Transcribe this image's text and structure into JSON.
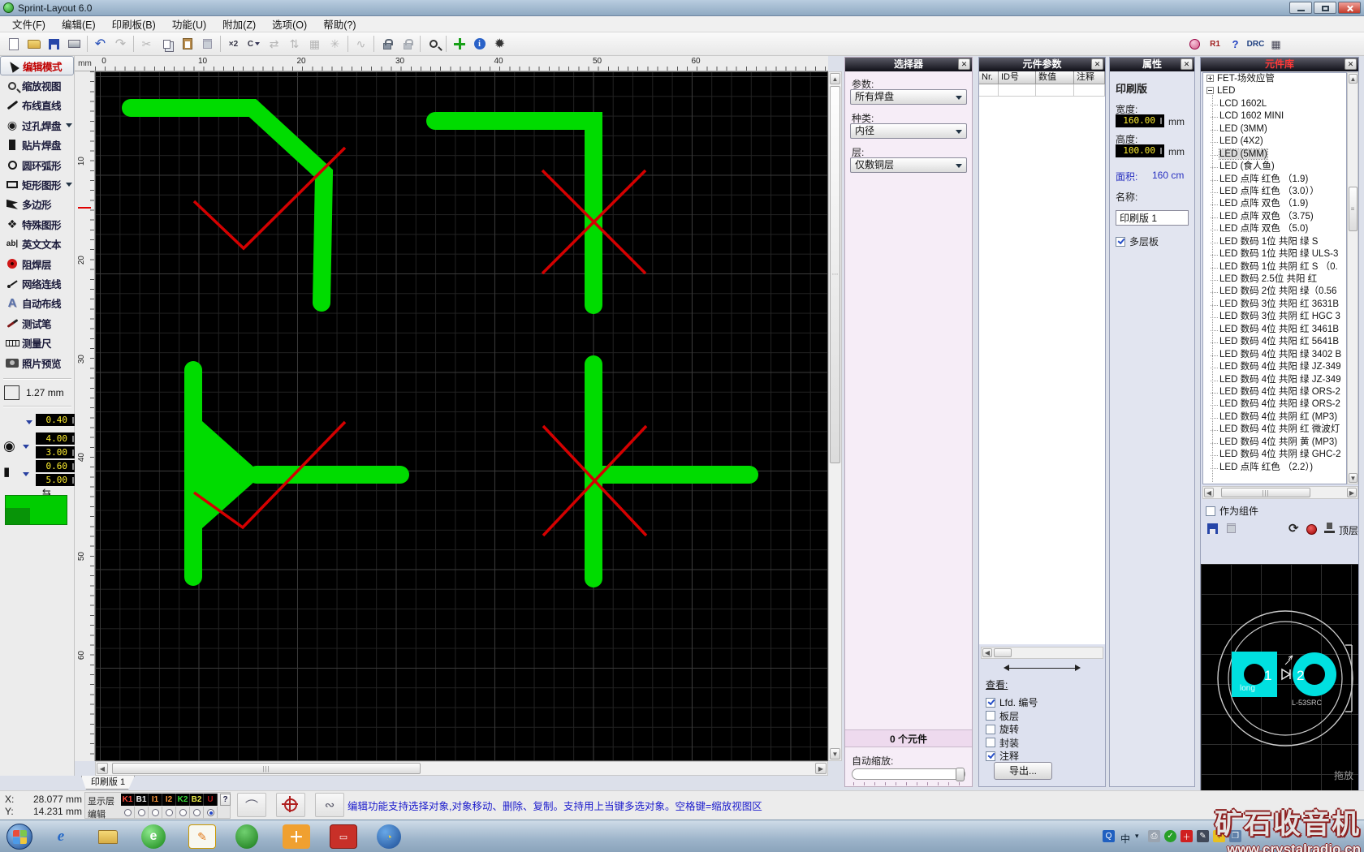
{
  "window": {
    "title": "Sprint-Layout 6.0"
  },
  "menu": {
    "items": [
      "文件(F)",
      "编辑(E)",
      "印刷板(B)",
      "功能(U)",
      "附加(Z)",
      "选项(O)",
      "帮助(?)"
    ]
  },
  "toolbar": {
    "x2": "×2",
    "rotate": "C",
    "r1": "R1",
    "help": "?",
    "drc": "DRC"
  },
  "tools": {
    "items": [
      {
        "label": "编辑模式",
        "icon": "cursor-icon",
        "active": true
      },
      {
        "label": "缩放视图",
        "icon": "magnifier-icon"
      },
      {
        "label": "布线直线",
        "icon": "line-icon"
      },
      {
        "label": "过孔焊盘",
        "icon": "pad-icon",
        "dropdown": true
      },
      {
        "label": "贴片焊盘",
        "icon": "smd-pad-icon"
      },
      {
        "label": "圆环弧形",
        "icon": "ring-icon"
      },
      {
        "label": "矩形图形",
        "icon": "rect-icon",
        "dropdown": true
      },
      {
        "label": "多边形",
        "icon": "polygon-icon"
      },
      {
        "label": "特殊图形",
        "icon": "special-shape-icon"
      },
      {
        "label": "英文文本",
        "icon": "text-icon"
      },
      {
        "label": "阻焊层",
        "icon": "solder-mask-icon"
      },
      {
        "label": "网络连线",
        "icon": "net-icon"
      },
      {
        "label": "自动布线",
        "icon": "autoroute-icon"
      },
      {
        "label": "测试笔",
        "icon": "probe-icon"
      },
      {
        "label": "测量尺",
        "icon": "ruler-icon"
      },
      {
        "label": "照片预览",
        "icon": "camera-icon"
      }
    ]
  },
  "grid": {
    "value": "1.27 mm"
  },
  "params": {
    "track": "0.40",
    "pad_outer": "4.00",
    "pad_inner": "3.00",
    "smd_w": "0.60",
    "smd_h": "5.00"
  },
  "rulers": {
    "unit": "mm",
    "top": [
      "0",
      "10",
      "20",
      "30",
      "40",
      "50",
      "60"
    ],
    "left": [
      "10",
      "20",
      "30",
      "40",
      "50",
      "60"
    ]
  },
  "selector": {
    "title": "选择器",
    "param_label": "参数:",
    "param_value": "所有焊盘",
    "kind_label": "种类:",
    "kind_value": "内径",
    "layer_label": "层:",
    "layer_value": "仅敷铜层",
    "count": "0 个元件",
    "autoscale_label": "自动缩放:"
  },
  "cparams": {
    "title": "元件参数",
    "columns": [
      "Nr.",
      "ID号",
      "数值",
      "注释"
    ],
    "view_label": "查看:",
    "checks": [
      {
        "label": "Lfd. 编号",
        "checked": true
      },
      {
        "label": "板层",
        "checked": false
      },
      {
        "label": "旋转",
        "checked": false
      },
      {
        "label": "封装",
        "checked": false
      },
      {
        "label": "注释",
        "checked": true
      }
    ],
    "export_label": "导出..."
  },
  "props": {
    "title": "属性",
    "section": "印刷版",
    "width_label": "宽度:",
    "width_value": "160.00",
    "width_unit": "mm",
    "height_label": "高度:",
    "height_value": "100.00",
    "height_unit": "mm",
    "area_label": "面积:",
    "area_value": "160 cm",
    "name_label": "名称:",
    "name_value": "印刷版 1",
    "multilayer_label": "多层板"
  },
  "library": {
    "title": "元件库",
    "items": [
      {
        "label": "FET-场效应管",
        "node": "collapsed"
      },
      {
        "label": "LED",
        "node": "expanded"
      },
      {
        "label": "LCD 1602L"
      },
      {
        "label": "LCD 1602 MINI"
      },
      {
        "label": "LED (3MM)"
      },
      {
        "label": "LED (4X2)"
      },
      {
        "label": "LED (5MM)",
        "selected": true
      },
      {
        "label": "LED (食人鱼)"
      },
      {
        "label": "LED 点阵 红色 （1.9)"
      },
      {
        "label": "LED 点阵 红色 （3.0））"
      },
      {
        "label": "LED 点阵 双色 （1.9)"
      },
      {
        "label": "LED 点阵 双色 （3.75)"
      },
      {
        "label": "LED 点阵 双色 （5.0)"
      },
      {
        "label": "LED 数码 1位 共阳 绿 S"
      },
      {
        "label": "LED 数码 1位 共阳 绿 ULS-3"
      },
      {
        "label": "LED 数码 1位 共阴 红 S （0."
      },
      {
        "label": "LED 数码 2.5位 共阳 红"
      },
      {
        "label": "LED 数码 2位 共阳 绿（0.56"
      },
      {
        "label": "LED 数码 3位 共阳 红 3631B"
      },
      {
        "label": "LED 数码 3位 共阴 红 HGC 3"
      },
      {
        "label": "LED 数码 4位 共阳 红 3461B"
      },
      {
        "label": "LED 数码 4位 共阳 红 5641B"
      },
      {
        "label": "LED 数码 4位 共阳 绿 3402 B"
      },
      {
        "label": "LED 数码 4位 共阳 绿 JZ-349"
      },
      {
        "label": "LED 数码 4位 共阳 绿 JZ-349"
      },
      {
        "label": "LED 数码 4位 共阳 绿 ORS-2"
      },
      {
        "label": "LED 数码 4位 共阳 绿 ORS-2"
      },
      {
        "label": "LED 数码 4位 共阴 红 (MP3)"
      },
      {
        "label": "LED 数码 4位 共阴 红 微波灯"
      },
      {
        "label": "LED 数码 4位 共阴 黄 (MP3)"
      },
      {
        "label": "LED 数码 4位 共阴 绿 GHC-2"
      },
      {
        "label": "LED 点阵 红色 （2.2）)"
      }
    ],
    "as_component_label": "作为组件",
    "top_layer_label": "顶层",
    "preview": {
      "pin1": "1",
      "pin1_note": "long",
      "pin2": "2",
      "part": "L-53SRC",
      "hint": "拖放"
    }
  },
  "tab": {
    "label": "印刷版 1"
  },
  "status": {
    "x_label": "X:",
    "x_value": "28.077 mm",
    "y_label": "Y:",
    "y_value": "14.231 mm",
    "show_label": "显示层",
    "edit_label": "编辑",
    "help": "?",
    "layers": [
      {
        "label": "K1",
        "color": "#ff4a3c"
      },
      {
        "label": "B1",
        "color": "#f0f0f0"
      },
      {
        "label": "I1",
        "color": "#ff9a3c"
      },
      {
        "label": "I2",
        "color": "#ff9a3c"
      },
      {
        "label": "K2",
        "color": "#38d838"
      },
      {
        "label": "B2",
        "color": "#e8e848"
      },
      {
        "label": "U",
        "color": "#b01818"
      }
    ],
    "message": "编辑功能支持选择对象,对象移动、删除、复制。支持用上当键多选对象。空格键=缩放视图区"
  },
  "tray": {
    "ime": "中"
  },
  "watermark": {
    "line1": "矿石收音机",
    "line2": "www.crystalradio.cn"
  },
  "colors": {
    "trace": "#00dc00",
    "error": "#d40000",
    "pad_cyan": "#00e0e0"
  }
}
